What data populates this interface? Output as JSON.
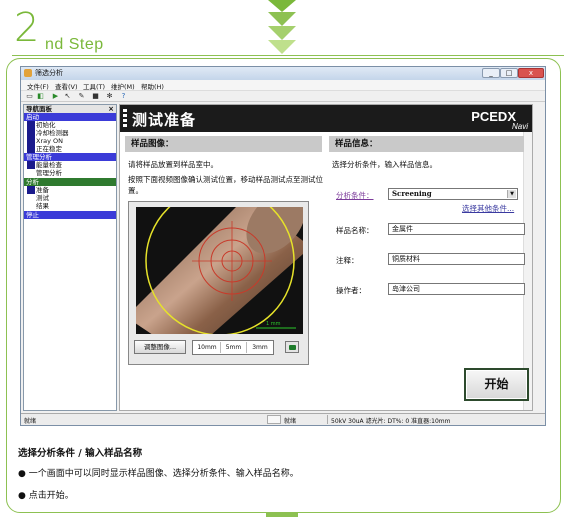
{
  "step": {
    "number": "2",
    "word": "nd Step"
  },
  "window": {
    "title": "筛选分析",
    "controls": [
      "_",
      "□",
      "x"
    ],
    "menu": [
      "文件(F)",
      "查看(V)",
      "工具(T)",
      "维护(M)",
      "帮助(H)"
    ]
  },
  "nav": {
    "header": "导航面板",
    "close": "×",
    "sections": [
      {
        "label": "启动",
        "items": [
          "初始化",
          "冷却检测器",
          "Xray ON",
          "正在稳定"
        ]
      },
      {
        "label": "管理分析",
        "items": [
          "能量检查",
          "管理分析"
        ]
      },
      {
        "label": "分析",
        "items": [
          "准备",
          "测试",
          "结果"
        ]
      },
      {
        "label": "停止",
        "items": []
      }
    ]
  },
  "content": {
    "title": "测试准备",
    "brand": "PCEDX",
    "brand_sub": "Navi"
  },
  "sample_image": {
    "header": "样品图像：",
    "instruction1": "请将样品放置到样品室中。",
    "instruction2": "按照下面视频图像确认测试位置，移动样品测试点至测试位置。",
    "adjust_button": "调整图像...",
    "zoom_options": [
      "10mm",
      "5mm",
      "3mm"
    ],
    "scale_label": "1 mm"
  },
  "sample_info": {
    "header": "样品信息：",
    "instruction": "选择分析条件，输入样品信息。",
    "condition_label": "分析条件：",
    "condition_value": "Screening",
    "other_conditions": "选择其他条件...",
    "name_label": "样品名称：",
    "name_value": "金属件",
    "comment_label": "注释：",
    "comment_value": "铜质材料",
    "operator_label": "操作者：",
    "operator_value": "岛津公司"
  },
  "start_button": "开始",
  "statusbar": {
    "left": "就绪",
    "mid": "就绪",
    "right": "50kV  30uA  滤光片: DT%: 0 准直器:10mm"
  },
  "caption": {
    "title": "选择分析条件 / 输入样品名称",
    "bullet_symbol": "●",
    "bullets": [
      "一个画面中可以同时显示样品图像、选择分析条件、输入样品名称。",
      "点击开始。"
    ]
  },
  "colors": {
    "accent_green": "#7ab83a",
    "frame_green": "#8dc152",
    "nav_section_blue": "#3b3bd8",
    "nav_marker": "#1a1a8c",
    "analysis_section_green": "#2f7a2f",
    "header_dark": "#1b1b1b"
  }
}
